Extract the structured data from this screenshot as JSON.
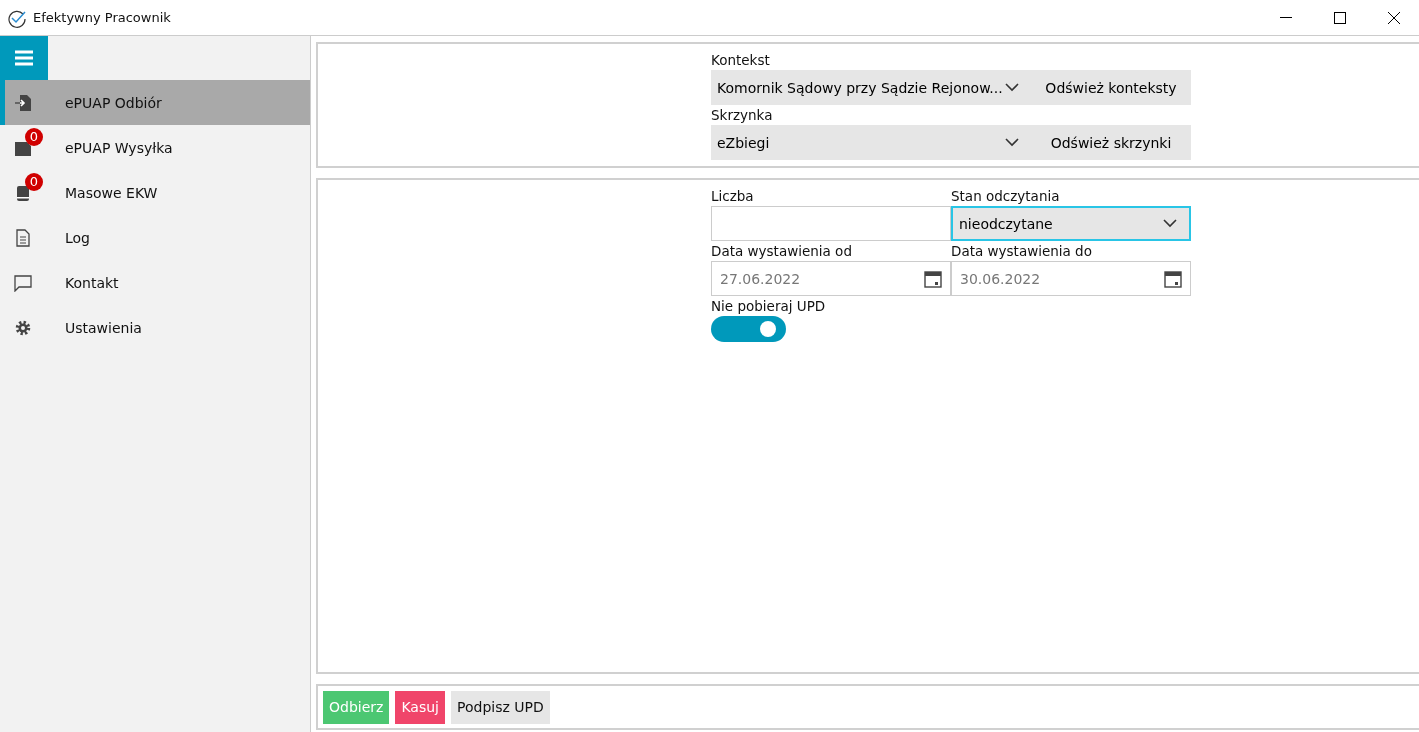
{
  "window": {
    "title": "Efektywny Pracownik"
  },
  "sidebar": {
    "items": [
      {
        "label": "ePUAP Odbiór",
        "kind": "inbox",
        "selected": true
      },
      {
        "label": "ePUAP Wysyłka",
        "kind": "send",
        "badge": "0",
        "selected": false
      },
      {
        "label": "Masowe EKW",
        "kind": "book",
        "badge": "0",
        "selected": false
      },
      {
        "label": "Log",
        "kind": "log",
        "selected": false
      },
      {
        "label": "Kontakt",
        "kind": "contact",
        "selected": false
      },
      {
        "label": "Ustawienia",
        "kind": "settings",
        "selected": false
      }
    ]
  },
  "context": {
    "kontekst_label": "Kontekst",
    "kontekst_value": "Komornik Sądowy przy Sądzie Rejonow...",
    "kontekst_button": "Odśwież konteksty",
    "skrzynka_label": "Skrzynka",
    "skrzynka_value": "eZbiegi",
    "skrzynka_button": "Odśwież skrzynki"
  },
  "filters": {
    "liczba_label": "Liczba",
    "stan_label": "Stan odczytania",
    "stan_value": "nieodczytane",
    "od_label": "Data wystawienia od",
    "od_value": "27.06.2022",
    "do_label": "Data wystawienia do",
    "do_value": "30.06.2022",
    "toggle_label": "Nie pobieraj UPD",
    "toggle_on": true
  },
  "buttons": [
    {
      "label": "Odbierz",
      "kind": "success"
    },
    {
      "label": "Kasuj",
      "kind": "danger"
    },
    {
      "label": "Podpisz UPD",
      "kind": "default"
    }
  ]
}
